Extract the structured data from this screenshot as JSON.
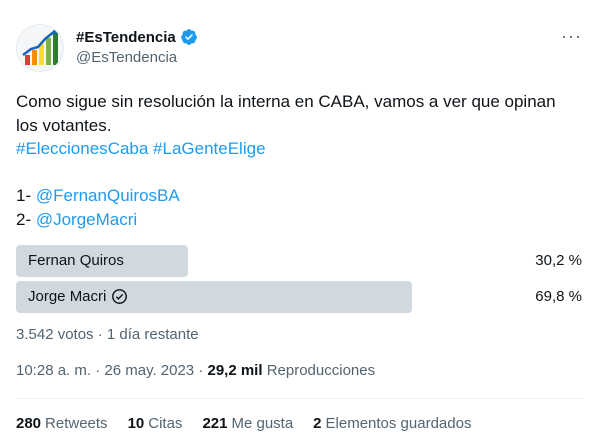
{
  "author": {
    "display_name": "#EsTendencia",
    "handle": "@EsTendencia",
    "verified_color": "#1d9bf0",
    "avatar_icon": "rising-bar-chart-icon"
  },
  "more_icon": "···",
  "tweet": {
    "line1": "Como sigue sin resolución la interna en CABA, vamos a ver que opinan",
    "line2": "los votantes.",
    "hashtag1": "#EleccionesCaba",
    "hashtag2": "#LaGenteElige",
    "item1_prefix": "1- ",
    "item1_mention": "@FernanQuirosBA",
    "item2_prefix": "2- ",
    "item2_mention": "@JorgeMacri"
  },
  "poll": {
    "options": [
      {
        "label": "Fernan Quiros",
        "percent_text": "30,2 %",
        "percent": 30.2,
        "winner": false
      },
      {
        "label": "Jorge Macri",
        "percent_text": "69,8 %",
        "percent": 69.8,
        "winner": true
      }
    ],
    "summary": "3.542 votos · 1 día restante"
  },
  "meta": {
    "time_date": "10:28 a. m. · 26 may. 2023 · ",
    "views_count": "29,2 mil",
    "views_label": " Reproducciones"
  },
  "stats": [
    {
      "count": "280",
      "label": "Retweets"
    },
    {
      "count": "10",
      "label": "Citas"
    },
    {
      "count": "221",
      "label": "Me gusta"
    },
    {
      "count": "2",
      "label": "Elementos guardados"
    }
  ]
}
